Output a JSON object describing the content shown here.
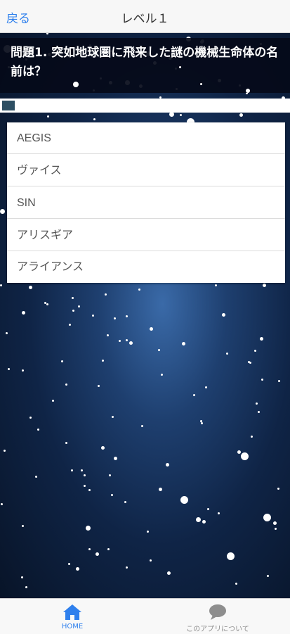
{
  "nav": {
    "back_label": "戻る",
    "title": "レベル１"
  },
  "question": {
    "text": "問題1. 突如地球圏に飛来した謎の機械生命体の名前は？"
  },
  "progress": {
    "current": 1,
    "total": 20
  },
  "answers": [
    {
      "label": "AEGIS"
    },
    {
      "label": "ヴァイス"
    },
    {
      "label": "SIN"
    },
    {
      "label": "アリスギア"
    },
    {
      "label": "アライアンス"
    }
  ],
  "tabbar": {
    "tabs": [
      {
        "label": "HOME",
        "icon": "home-icon",
        "active": true
      },
      {
        "label": "このアプリについて",
        "icon": "chat-bubble-icon",
        "active": false
      }
    ]
  },
  "colors": {
    "accent": "#2f80ed",
    "inactive": "#8e8e8e",
    "progress": "#2d4f63"
  }
}
